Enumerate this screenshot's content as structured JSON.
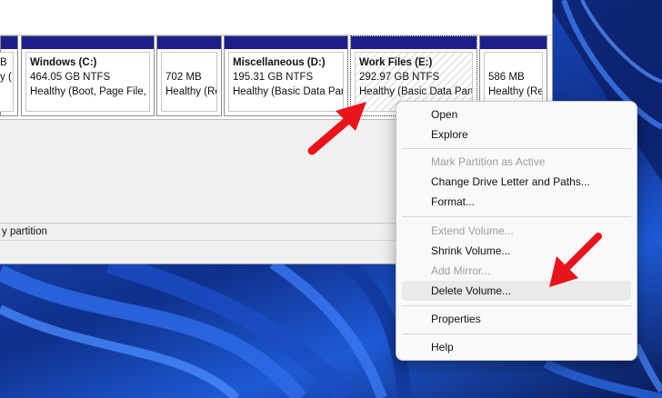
{
  "partitions": [
    {
      "name": "",
      "size": "B",
      "status": "y ("
    },
    {
      "name": "Windows  (C:)",
      "size": "464.05 GB NTFS",
      "status": "Healthy (Boot, Page File,"
    },
    {
      "name": "",
      "size": "702 MB",
      "status": "Healthy (Re"
    },
    {
      "name": "Miscellaneous  (D:)",
      "size": "195.31 GB NTFS",
      "status": "Healthy (Basic Data Par"
    },
    {
      "name": "Work Files  (E:)",
      "size": "292.97 GB NTFS",
      "status": "Healthy (Basic Data Part"
    },
    {
      "name": "",
      "size": "586 MB",
      "status": "Healthy (Re"
    }
  ],
  "legend": {
    "text": "y partition"
  },
  "context_menu": {
    "items": [
      {
        "label": "Open",
        "enabled": true
      },
      {
        "label": "Explore",
        "enabled": true
      },
      {
        "label": "Mark Partition as Active",
        "enabled": false
      },
      {
        "label": "Change Drive Letter and Paths...",
        "enabled": true
      },
      {
        "label": "Format...",
        "enabled": true
      },
      {
        "label": "Extend Volume...",
        "enabled": false
      },
      {
        "label": "Shrink Volume...",
        "enabled": true
      },
      {
        "label": "Add Mirror...",
        "enabled": false
      },
      {
        "label": "Delete Volume...",
        "enabled": true
      },
      {
        "label": "Properties",
        "enabled": true
      },
      {
        "label": "Help",
        "enabled": true
      }
    ]
  },
  "colors": {
    "partition_header": "#1d1e8a",
    "annotation_arrow": "#e8141b",
    "menu_background": "#f9f9f9"
  },
  "icons": [
    "red-arrow-annotation-icon"
  ]
}
